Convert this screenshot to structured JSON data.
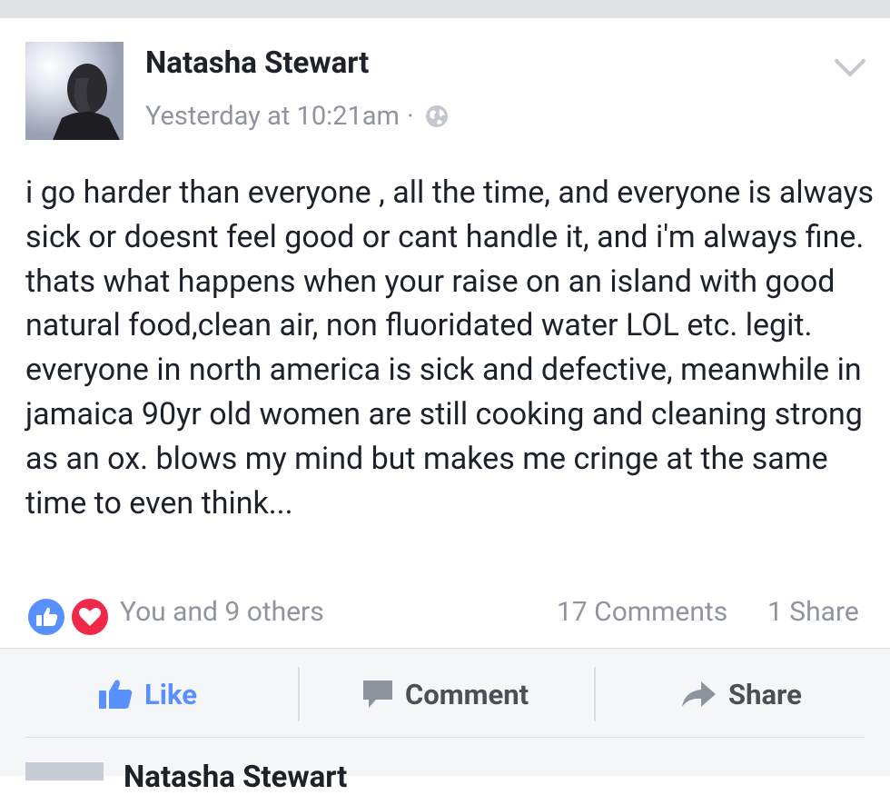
{
  "post": {
    "author": "Natasha Stewart",
    "timestamp": "Yesterday at 10:21am",
    "separator": "·",
    "privacy_icon": "globe-icon",
    "menu_icon": "chevron-down-icon",
    "text": "i go harder than everyone , all the time, and everyone is always sick or doesnt feel good or cant handle it, and i'm always fine. thats what happens when your raise on an island with good natural food,clean air, non fluoridated water LOL etc. legit. everyone in north america is sick and defective, meanwhile in jamaica 90yr old women are still cooking and cleaning strong as an ox. blows my mind but makes me cringe at the same time to even think..."
  },
  "reactions": {
    "icons": [
      "like-reaction-icon",
      "love-reaction-icon"
    ],
    "summary": "You and 9 others",
    "comments": "17 Comments",
    "shares": "1 Share"
  },
  "actions": {
    "like": "Like",
    "comment": "Comment",
    "share": "Share"
  },
  "next_post": {
    "author": "Natasha Stewart"
  },
  "colors": {
    "accent": "#5890ff",
    "love": "#f0284a",
    "text": "#1d2129",
    "meta": "#90949c",
    "action_text": "#4b4f56"
  }
}
